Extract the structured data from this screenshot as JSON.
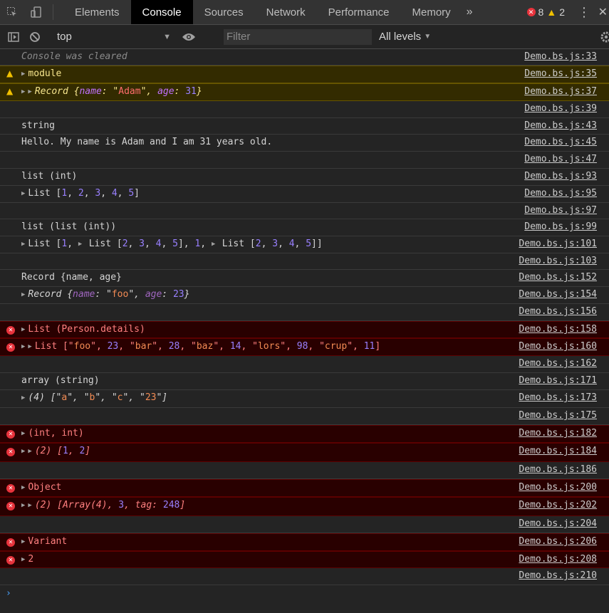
{
  "tabs": [
    "Elements",
    "Console",
    "Sources",
    "Network",
    "Performance",
    "Memory"
  ],
  "active_tab": "Console",
  "more_tabs": "»",
  "counters": {
    "errors": "8",
    "warnings": "2"
  },
  "toolbar": {
    "context": "top",
    "filter_placeholder": "Filter",
    "levels": "All levels"
  },
  "prompt": "›",
  "rows": [
    {
      "type": "info",
      "msg": "Console was cleared",
      "italic": true,
      "src": "Demo.bs.js:33"
    },
    {
      "type": "warn",
      "msg": "module",
      "expand": 1,
      "src": "Demo.bs.js:35"
    },
    {
      "type": "warn",
      "msgParts": [
        {
          "t": "Record {",
          "c": "it"
        },
        {
          "t": "name",
          "c": "key"
        },
        {
          "t": ": \"",
          "c": "it"
        },
        {
          "t": "Adam",
          "c": "str"
        },
        {
          "t": "\", ",
          "c": "it"
        },
        {
          "t": "age",
          "c": "key"
        },
        {
          "t": ": ",
          "c": "it"
        },
        {
          "t": "31",
          "c": "num"
        },
        {
          "t": "}",
          "c": "it"
        }
      ],
      "expand": 2,
      "src": "Demo.bs.js:37"
    },
    {
      "type": "info",
      "msg": "",
      "src": "Demo.bs.js:39"
    },
    {
      "type": "info",
      "msg": "string",
      "src": "Demo.bs.js:43"
    },
    {
      "type": "info",
      "msg": "Hello. My name is Adam and I am 31 years old.",
      "src": "Demo.bs.js:45"
    },
    {
      "type": "info",
      "msg": "",
      "src": "Demo.bs.js:47"
    },
    {
      "type": "info",
      "msg": "list (int)",
      "src": "Demo.bs.js:93"
    },
    {
      "type": "info",
      "msgParts": [
        {
          "t": "List [",
          "c": ""
        },
        {
          "t": "1",
          "c": "num"
        },
        {
          "t": ", ",
          "c": ""
        },
        {
          "t": "2",
          "c": "num"
        },
        {
          "t": ", ",
          "c": ""
        },
        {
          "t": "3",
          "c": "num"
        },
        {
          "t": ", ",
          "c": ""
        },
        {
          "t": "4",
          "c": "num"
        },
        {
          "t": ", ",
          "c": ""
        },
        {
          "t": "5",
          "c": "num"
        },
        {
          "t": "]",
          "c": ""
        }
      ],
      "expand": 1,
      "src": "Demo.bs.js:95"
    },
    {
      "type": "info",
      "msg": "",
      "src": "Demo.bs.js:97"
    },
    {
      "type": "info",
      "msg": "list (list (int))",
      "src": "Demo.bs.js:99"
    },
    {
      "type": "info",
      "msgParts": [
        {
          "t": "List [",
          "c": ""
        },
        {
          "t": "1",
          "c": "num"
        },
        {
          "t": ", ",
          "c": ""
        },
        {
          "t": "▶ ",
          "c": "tri-inline"
        },
        {
          "t": "List [",
          "c": ""
        },
        {
          "t": "2",
          "c": "num"
        },
        {
          "t": ", ",
          "c": ""
        },
        {
          "t": "3",
          "c": "num"
        },
        {
          "t": ", ",
          "c": ""
        },
        {
          "t": "4",
          "c": "num"
        },
        {
          "t": ", ",
          "c": ""
        },
        {
          "t": "5",
          "c": "num"
        },
        {
          "t": "], ",
          "c": ""
        },
        {
          "t": "1",
          "c": "num"
        },
        {
          "t": ", ",
          "c": ""
        },
        {
          "t": "▶ ",
          "c": "tri-inline"
        },
        {
          "t": "List [",
          "c": ""
        },
        {
          "t": "2",
          "c": "num"
        },
        {
          "t": ", ",
          "c": ""
        },
        {
          "t": "3",
          "c": "num"
        },
        {
          "t": ", ",
          "c": ""
        },
        {
          "t": "4",
          "c": "num"
        },
        {
          "t": ", ",
          "c": ""
        },
        {
          "t": "5",
          "c": "num"
        },
        {
          "t": "]]",
          "c": ""
        }
      ],
      "expand": 1,
      "src": "Demo.bs.js:101"
    },
    {
      "type": "info",
      "msg": "",
      "src": "Demo.bs.js:103"
    },
    {
      "type": "info",
      "msg": "Record {name, age}",
      "src": "Demo.bs.js:152"
    },
    {
      "type": "info",
      "msgParts": [
        {
          "t": "Record {",
          "c": "it"
        },
        {
          "t": "name",
          "c": "key"
        },
        {
          "t": ": \"",
          "c": "it"
        },
        {
          "t": "foo",
          "c": "str"
        },
        {
          "t": "\", ",
          "c": "it"
        },
        {
          "t": "age",
          "c": "key"
        },
        {
          "t": ": ",
          "c": "it"
        },
        {
          "t": "23",
          "c": "num"
        },
        {
          "t": "}",
          "c": "it"
        }
      ],
      "expand": 1,
      "src": "Demo.bs.js:154"
    },
    {
      "type": "info",
      "msg": "",
      "src": "Demo.bs.js:156"
    },
    {
      "type": "error",
      "msg": "List (Person.details)",
      "expand": 1,
      "src": "Demo.bs.js:158"
    },
    {
      "type": "error",
      "msgParts": [
        {
          "t": "List [\"",
          "c": ""
        },
        {
          "t": "foo",
          "c": "str"
        },
        {
          "t": "\", ",
          "c": ""
        },
        {
          "t": "23",
          "c": "num"
        },
        {
          "t": ", \"",
          "c": ""
        },
        {
          "t": "bar",
          "c": "str"
        },
        {
          "t": "\", ",
          "c": ""
        },
        {
          "t": "28",
          "c": "num"
        },
        {
          "t": ", \"",
          "c": ""
        },
        {
          "t": "baz",
          "c": "str"
        },
        {
          "t": "\", ",
          "c": ""
        },
        {
          "t": "14",
          "c": "num"
        },
        {
          "t": ", \"",
          "c": ""
        },
        {
          "t": "lors",
          "c": "str"
        },
        {
          "t": "\", ",
          "c": ""
        },
        {
          "t": "98",
          "c": "num"
        },
        {
          "t": ", \"",
          "c": ""
        },
        {
          "t": "crup",
          "c": "str"
        },
        {
          "t": "\", ",
          "c": ""
        },
        {
          "t": "11",
          "c": "num"
        },
        {
          "t": "]",
          "c": ""
        }
      ],
      "expand": 2,
      "src": "Demo.bs.js:160"
    },
    {
      "type": "info",
      "msg": "",
      "src": "Demo.bs.js:162"
    },
    {
      "type": "info",
      "msg": "array (string)",
      "src": "Demo.bs.js:171"
    },
    {
      "type": "info",
      "msgParts": [
        {
          "t": "(4) [\"",
          "c": "it"
        },
        {
          "t": "a",
          "c": "str"
        },
        {
          "t": "\", \"",
          "c": "it"
        },
        {
          "t": "b",
          "c": "str"
        },
        {
          "t": "\", \"",
          "c": "it"
        },
        {
          "t": "c",
          "c": "str"
        },
        {
          "t": "\", \"",
          "c": "it"
        },
        {
          "t": "23",
          "c": "str"
        },
        {
          "t": "\"]",
          "c": "it"
        }
      ],
      "expand": 1,
      "src": "Demo.bs.js:173"
    },
    {
      "type": "info",
      "msg": "",
      "src": "Demo.bs.js:175"
    },
    {
      "type": "error",
      "msg": "(int, int)",
      "expand": 1,
      "src": "Demo.bs.js:182"
    },
    {
      "type": "error",
      "msgParts": [
        {
          "t": "(2) [",
          "c": "it"
        },
        {
          "t": "1",
          "c": "num"
        },
        {
          "t": ", ",
          "c": "it"
        },
        {
          "t": "2",
          "c": "num"
        },
        {
          "t": "]",
          "c": "it"
        }
      ],
      "expand": 2,
      "src": "Demo.bs.js:184"
    },
    {
      "type": "info",
      "msg": "",
      "src": "Demo.bs.js:186"
    },
    {
      "type": "error",
      "msg": "Object",
      "expand": 1,
      "src": "Demo.bs.js:200"
    },
    {
      "type": "error",
      "msgParts": [
        {
          "t": "(2) [Array(4), ",
          "c": "it"
        },
        {
          "t": "3",
          "c": "num"
        },
        {
          "t": ", tag: ",
          "c": "it"
        },
        {
          "t": "248",
          "c": "num"
        },
        {
          "t": "]",
          "c": "it"
        }
      ],
      "expand": 2,
      "src": "Demo.bs.js:202"
    },
    {
      "type": "info",
      "msg": "",
      "src": "Demo.bs.js:204"
    },
    {
      "type": "error",
      "msg": "Variant",
      "expand": 1,
      "src": "Demo.bs.js:206"
    },
    {
      "type": "error",
      "msg": "2",
      "expand": 1,
      "src": "Demo.bs.js:208"
    },
    {
      "type": "info",
      "msg": "",
      "src": "Demo.bs.js:210"
    }
  ]
}
